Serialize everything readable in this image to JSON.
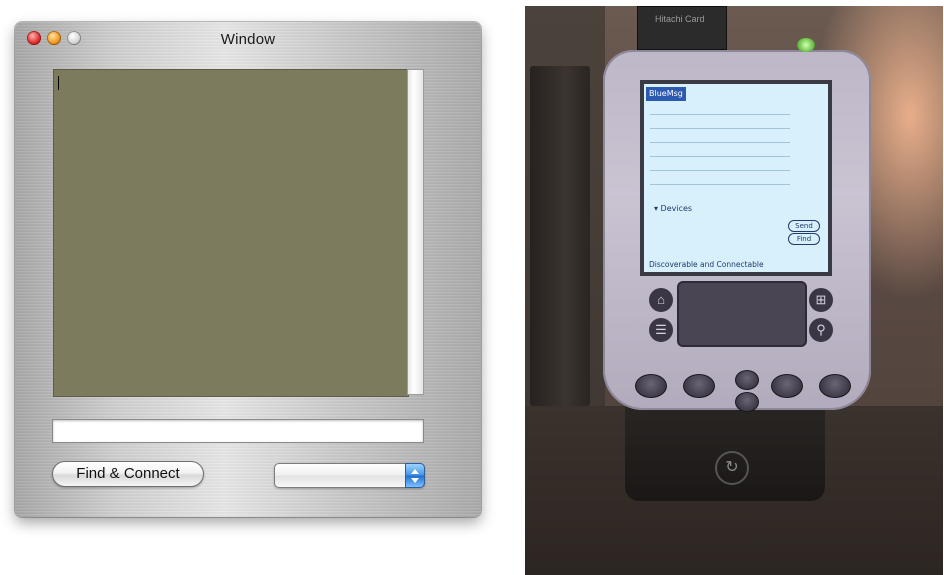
{
  "window": {
    "title": "Window",
    "find_connect_label": "Find & Connect",
    "device_popup_value": "",
    "message_input_value": ""
  },
  "photo": {
    "card_text": "Hitachi Card",
    "screen": {
      "app_title": "BlueMsg",
      "devices_label": "▾ Devices",
      "send_label": "Send",
      "find_label": "Find",
      "status_text": "Discoverable and Connectable"
    }
  },
  "colors": {
    "textview_bg": "#7c7b5e",
    "popup_arrow_blue": "#3f93e6",
    "pda_screen": "#d7f0fb"
  }
}
